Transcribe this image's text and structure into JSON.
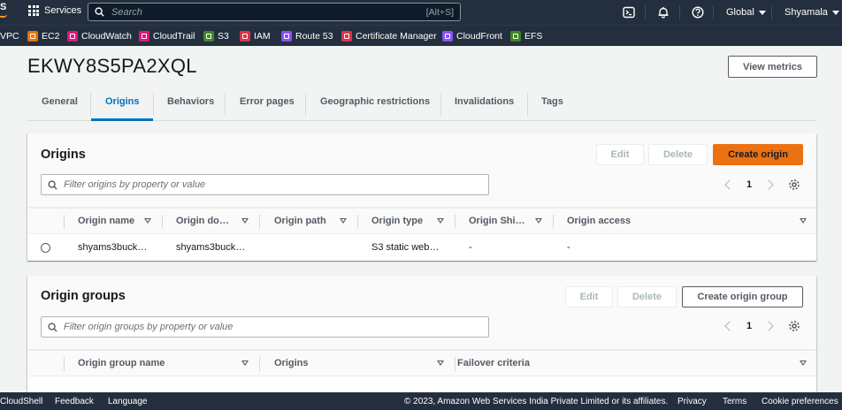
{
  "topnav": {
    "logo_text": "S",
    "services_label": "Services",
    "search_placeholder": "Search",
    "search_shortcut": "[Alt+S]",
    "region_label": "Global",
    "user_label": "Shyamala"
  },
  "favorites": [
    {
      "label": "VPC",
      "color": ""
    },
    {
      "label": "EC2",
      "color": "#ed7100"
    },
    {
      "label": "CloudWatch",
      "color": "#e7157b"
    },
    {
      "label": "CloudTrail",
      "color": "#e7157b"
    },
    {
      "label": "S3",
      "color": "#3f8624"
    },
    {
      "label": "IAM",
      "color": "#dd344c"
    },
    {
      "label": "Route 53",
      "color": "#8c4fff"
    },
    {
      "label": "Certificate Manager",
      "color": "#dd344c"
    },
    {
      "label": "CloudFront",
      "color": "#8c4fff"
    },
    {
      "label": "EFS",
      "color": "#3f8624"
    }
  ],
  "page": {
    "title": "EKWY8S5PA2XQL",
    "view_metrics_label": "View metrics"
  },
  "tabs": [
    {
      "label": "General"
    },
    {
      "label": "Origins"
    },
    {
      "label": "Behaviors"
    },
    {
      "label": "Error pages"
    },
    {
      "label": "Geographic restrictions"
    },
    {
      "label": "Invalidations"
    },
    {
      "label": "Tags"
    }
  ],
  "active_tab": "Origins",
  "origins": {
    "title": "Origins",
    "edit_label": "Edit",
    "delete_label": "Delete",
    "create_label": "Create origin",
    "filter_placeholder": "Filter origins by property or value",
    "page_number": "1",
    "columns": [
      "Origin name",
      "Origin do…",
      "Origin path",
      "Origin type",
      "Origin Shi…",
      "Origin access"
    ],
    "rows": [
      [
        "shyams3buck…",
        "shyams3buck…",
        "",
        "S3 static web…",
        "-",
        "-"
      ]
    ]
  },
  "origin_groups": {
    "title": "Origin groups",
    "edit_label": "Edit",
    "delete_label": "Delete",
    "create_label": "Create origin group",
    "filter_placeholder": "Filter origin groups by property or value",
    "page_number": "1",
    "columns": [
      "Origin group name",
      "Origins",
      "Failover criteria"
    ]
  },
  "footer": {
    "cloudshell": "CloudShell",
    "feedback": "Feedback",
    "language": "Language",
    "copyright": "© 2023, Amazon Web Services India Private Limited or its affiliates.",
    "privacy": "Privacy",
    "terms": "Terms",
    "cookies": "Cookie preferences"
  },
  "colors": {
    "nav_bg": "#232f3e",
    "accent_orange": "#ec7211",
    "link_blue": "#0073bb"
  }
}
